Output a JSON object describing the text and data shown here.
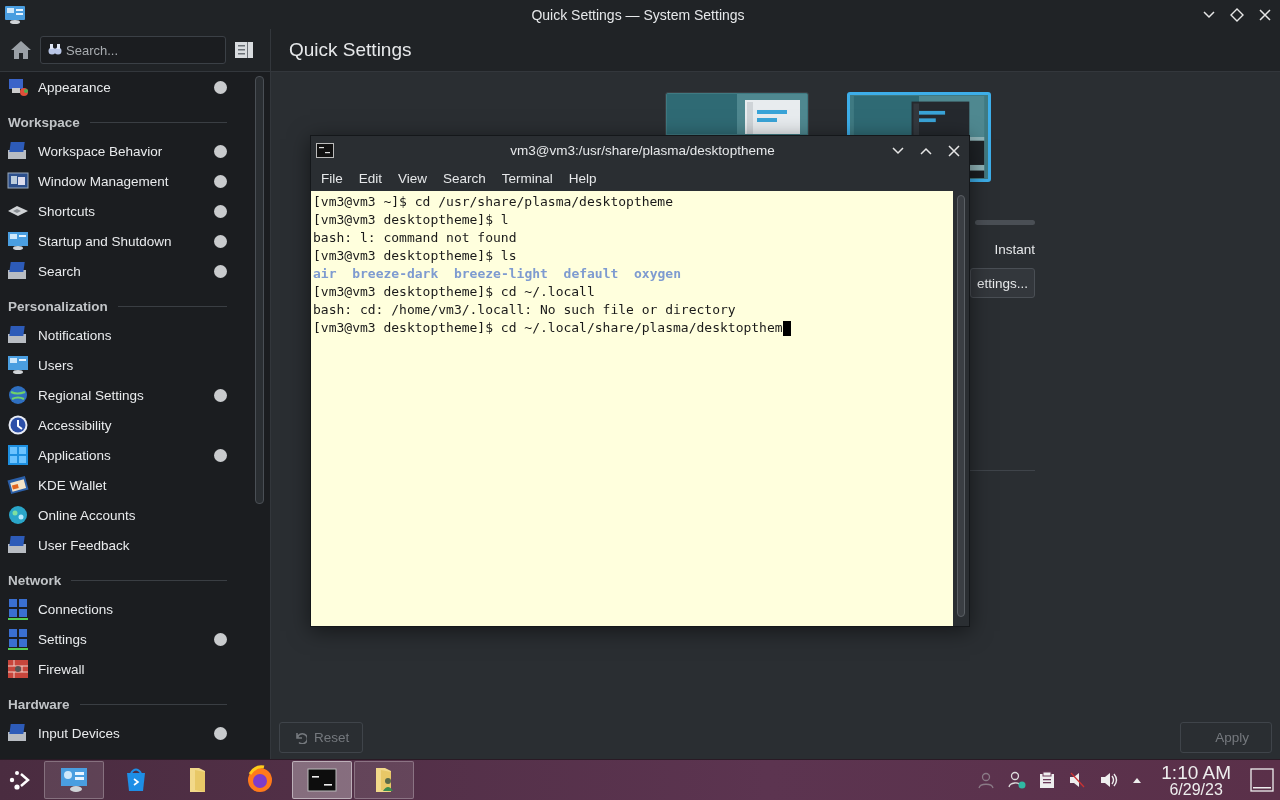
{
  "window": {
    "title": "Quick Settings — System Settings"
  },
  "search": {
    "placeholder": "Search..."
  },
  "page_title": "Quick Settings",
  "sidebar": {
    "sections": [
      {
        "items": [
          {
            "label": "Appearance",
            "modified": true
          }
        ]
      },
      {
        "header": "Workspace",
        "items": [
          {
            "label": "Workspace Behavior",
            "modified": true
          },
          {
            "label": "Window Management",
            "modified": true
          },
          {
            "label": "Shortcuts",
            "modified": true
          },
          {
            "label": "Startup and Shutdown",
            "modified": true
          },
          {
            "label": "Search",
            "modified": true
          }
        ]
      },
      {
        "header": "Personalization",
        "items": [
          {
            "label": "Notifications",
            "modified": false
          },
          {
            "label": "Users",
            "modified": false
          },
          {
            "label": "Regional Settings",
            "modified": true
          },
          {
            "label": "Accessibility",
            "modified": false
          },
          {
            "label": "Applications",
            "modified": true
          },
          {
            "label": "KDE Wallet",
            "modified": false
          },
          {
            "label": "Online Accounts",
            "modified": false
          },
          {
            "label": "User Feedback",
            "modified": false
          }
        ]
      },
      {
        "header": "Network",
        "items": [
          {
            "label": "Connections",
            "modified": false
          },
          {
            "label": "Settings",
            "modified": true
          },
          {
            "label": "Firewall",
            "modified": false
          }
        ]
      },
      {
        "header": "Hardware",
        "items": [
          {
            "label": "Input Devices",
            "modified": true
          }
        ]
      }
    ]
  },
  "themes": [
    {
      "kind": "picture",
      "selected": false
    },
    {
      "kind": "picture",
      "selected": true
    }
  ],
  "animation_speed": {
    "end_label": "Instant"
  },
  "settings_button": "ettings...",
  "buttons": [
    {
      "label": "Reset",
      "disabled": true
    },
    {
      "label": "Apply",
      "disabled": true
    }
  ],
  "terminal": {
    "title": "vm3@vm3:/usr/share/plasma/desktoptheme",
    "menu": [
      "File",
      "Edit",
      "View",
      "Search",
      "Terminal",
      "Help"
    ],
    "lines": [
      {
        "kind": "plain",
        "text": "[vm3@vm3 ~]$ cd /usr/share/plasma/desktoptheme",
        "cursor": false
      },
      {
        "kind": "plain",
        "text": "[vm3@vm3 desktoptheme]$ l",
        "cursor": false
      },
      {
        "kind": "plain",
        "text": "bash: l: command not found",
        "cursor": false
      },
      {
        "kind": "plain",
        "text": "[vm3@vm3 desktoptheme]$ ls",
        "cursor": false
      },
      {
        "kind": "listing",
        "entries": [
          "air",
          "breeze-dark",
          "breeze-light",
          "default",
          "oxygen"
        ],
        "cursor": false
      },
      {
        "kind": "plain",
        "text": "[vm3@vm3 desktoptheme]$ cd ~/.locall",
        "cursor": false
      },
      {
        "kind": "plain",
        "text": "bash: cd: /home/vm3/.locall: No such file or directory",
        "cursor": false
      },
      {
        "kind": "plain",
        "text": "[vm3@vm3 desktoptheme]$ cd ~/.local/share/plasma/desktopthem",
        "cursor": true
      }
    ]
  },
  "taskbar": {
    "tasks": [
      {
        "open": true,
        "focused": false
      },
      {
        "open": false,
        "focused": false
      },
      {
        "open": false,
        "focused": false
      },
      {
        "open": false,
        "focused": false
      },
      {
        "open": true,
        "focused": true
      },
      {
        "open": true,
        "focused": false
      }
    ],
    "clock": {
      "time": "1:10 AM",
      "date": "6/29/23"
    }
  }
}
